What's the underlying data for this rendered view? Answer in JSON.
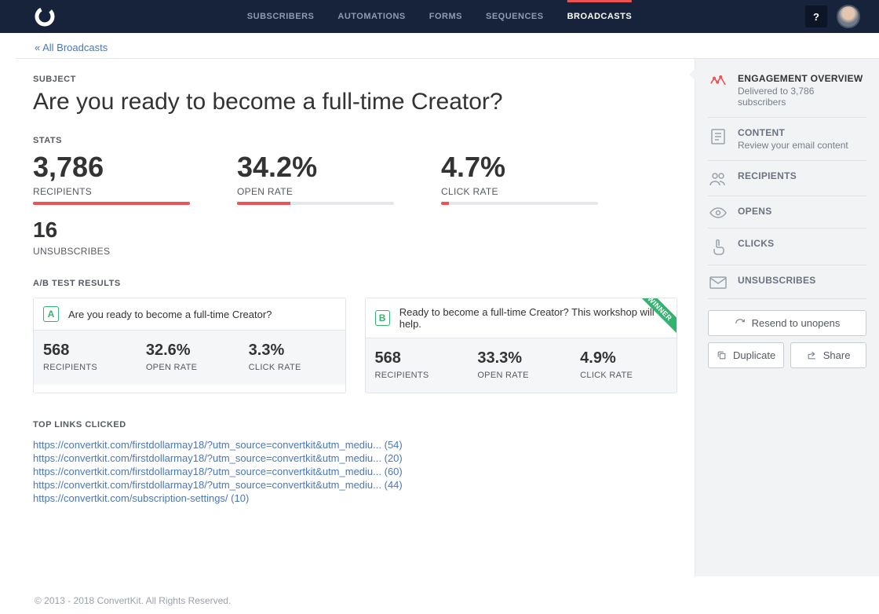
{
  "nav": {
    "items": [
      "SUBSCRIBERS",
      "AUTOMATIONS",
      "FORMS",
      "SEQUENCES",
      "BROADCASTS"
    ],
    "active_index": 4,
    "help_label": "?"
  },
  "breadcrumb": {
    "back_label": "« All Broadcasts"
  },
  "subject": {
    "label": "SUBJECT",
    "title": "Are you ready to become a full-time Creator?"
  },
  "stats": {
    "label": "STATS",
    "items": [
      {
        "value": "3,786",
        "label": "RECIPIENTS",
        "fill_pct": 100
      },
      {
        "value": "34.2%",
        "label": "OPEN RATE",
        "fill_pct": 34
      },
      {
        "value": "4.7%",
        "label": "CLICK RATE",
        "fill_pct": 5
      }
    ],
    "unsubscribes": {
      "value": "16",
      "label": "UNSUBSCRIBES"
    }
  },
  "ab": {
    "label": "A/B TEST RESULTS",
    "variants": [
      {
        "letter": "A",
        "title": "Are you ready to become a full-time Creator?",
        "winner": false,
        "stats": [
          {
            "value": "568",
            "label": "RECIPIENTS"
          },
          {
            "value": "32.6%",
            "label": "OPEN RATE"
          },
          {
            "value": "3.3%",
            "label": "CLICK RATE"
          }
        ]
      },
      {
        "letter": "B",
        "title": "Ready to become a full-time Creator? This workshop will help.",
        "winner": true,
        "stats": [
          {
            "value": "568",
            "label": "RECIPIENTS"
          },
          {
            "value": "33.3%",
            "label": "OPEN RATE"
          },
          {
            "value": "4.9%",
            "label": "CLICK RATE"
          }
        ]
      }
    ],
    "winner_label": "WINNER"
  },
  "top_links": {
    "label": "TOP LINKS CLICKED",
    "items": [
      {
        "text": "https://convertkit.com/firstdollarmay18/?utm_source=convertkit&utm_mediu...",
        "count": "(54)"
      },
      {
        "text": "https://convertkit.com/firstdollarmay18/?utm_source=convertkit&utm_mediu...",
        "count": "(20)"
      },
      {
        "text": "https://convertkit.com/firstdollarmay18/?utm_source=convertkit&utm_mediu...",
        "count": "(60)"
      },
      {
        "text": "https://convertkit.com/firstdollarmay18/?utm_source=convertkit&utm_mediu...",
        "count": "(44)"
      },
      {
        "text": "https://convertkit.com/subscription-settings/",
        "count": "(10)"
      }
    ]
  },
  "sidebar": {
    "items": [
      {
        "title": "ENGAGEMENT OVERVIEW",
        "sub": "Delivered to 3,786 subscribers",
        "icon": "activity",
        "active": true
      },
      {
        "title": "CONTENT",
        "sub": "Review your email content",
        "icon": "doc",
        "active": false
      },
      {
        "title": "RECIPIENTS",
        "sub": "",
        "icon": "users",
        "active": false
      },
      {
        "title": "OPENS",
        "sub": "",
        "icon": "eye",
        "active": false
      },
      {
        "title": "CLICKS",
        "sub": "",
        "icon": "pointer",
        "active": false
      },
      {
        "title": "UNSUBSCRIBES",
        "sub": "",
        "icon": "mail",
        "active": false
      }
    ],
    "resend_label": "Resend to unopens",
    "duplicate_label": "Duplicate",
    "share_label": "Share"
  },
  "footer": {
    "copyright": "© 2013 - 2018 ConvertKit. All Rights Reserved."
  }
}
